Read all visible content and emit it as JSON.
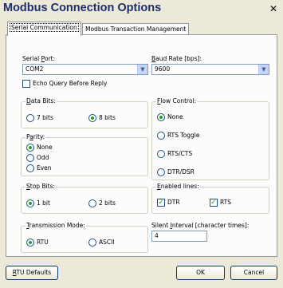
{
  "window": {
    "title": "Modbus Connection Options",
    "close": "✕"
  },
  "tabs": [
    {
      "label": "Serial Communication",
      "active": true
    },
    {
      "label": "Modbus Transaction Management",
      "active": false
    }
  ],
  "serial_port": {
    "label_pre": "Serial ",
    "label_key": "P",
    "label_post": "ort:",
    "value": "COM2"
  },
  "baud_rate": {
    "label_key": "B",
    "label_post": "aud Rate [bps]:",
    "value": "9600"
  },
  "echo": {
    "label": "Echo Query Before Reply",
    "checked": false
  },
  "data_bits": {
    "label_key": "D",
    "label_post": "ata Bits:",
    "options": [
      {
        "label": "7 bits",
        "selected": false
      },
      {
        "label": "8 bits",
        "selected": true
      }
    ]
  },
  "parity": {
    "label_pre": "P",
    "label_key": "a",
    "label_post": "rity:",
    "options": [
      {
        "label": "None",
        "selected": true
      },
      {
        "label": "Odd",
        "selected": false
      },
      {
        "label": "Even",
        "selected": false
      }
    ]
  },
  "stop_bits": {
    "label_key": "S",
    "label_post": "top Bits:",
    "options": [
      {
        "label": "1 bit",
        "selected": true
      },
      {
        "label": "2 bits",
        "selected": false
      }
    ]
  },
  "transmission_mode": {
    "label_key": "T",
    "label_post": "ransmission Mode:",
    "options": [
      {
        "label": "RTU",
        "selected": true
      },
      {
        "label": "ASCII",
        "selected": false
      }
    ]
  },
  "flow_control": {
    "label_key": "F",
    "label_post": "low Control:",
    "options": [
      {
        "label": "None",
        "selected": true
      },
      {
        "label": "RTS Toggle",
        "selected": false
      },
      {
        "label": "RTS/CTS",
        "selected": false
      },
      {
        "label": "DTR/DSR",
        "selected": false
      }
    ]
  },
  "enabled_lines": {
    "label_key": "E",
    "label_post": "nabled lines:",
    "dtr": {
      "label": "DTR",
      "checked": true
    },
    "rts": {
      "label": "RTS",
      "checked": true
    }
  },
  "silent_interval": {
    "label_pre": "Silent ",
    "label_key": "I",
    "label_post": "nterval [character times]:",
    "value": "4"
  },
  "buttons": {
    "rtu_defaults_key": "R",
    "rtu_defaults_post": "TU Defaults",
    "ok": "OK",
    "cancel": "Cancel"
  },
  "icons": {
    "dropdown": "▼",
    "check": "✓"
  }
}
